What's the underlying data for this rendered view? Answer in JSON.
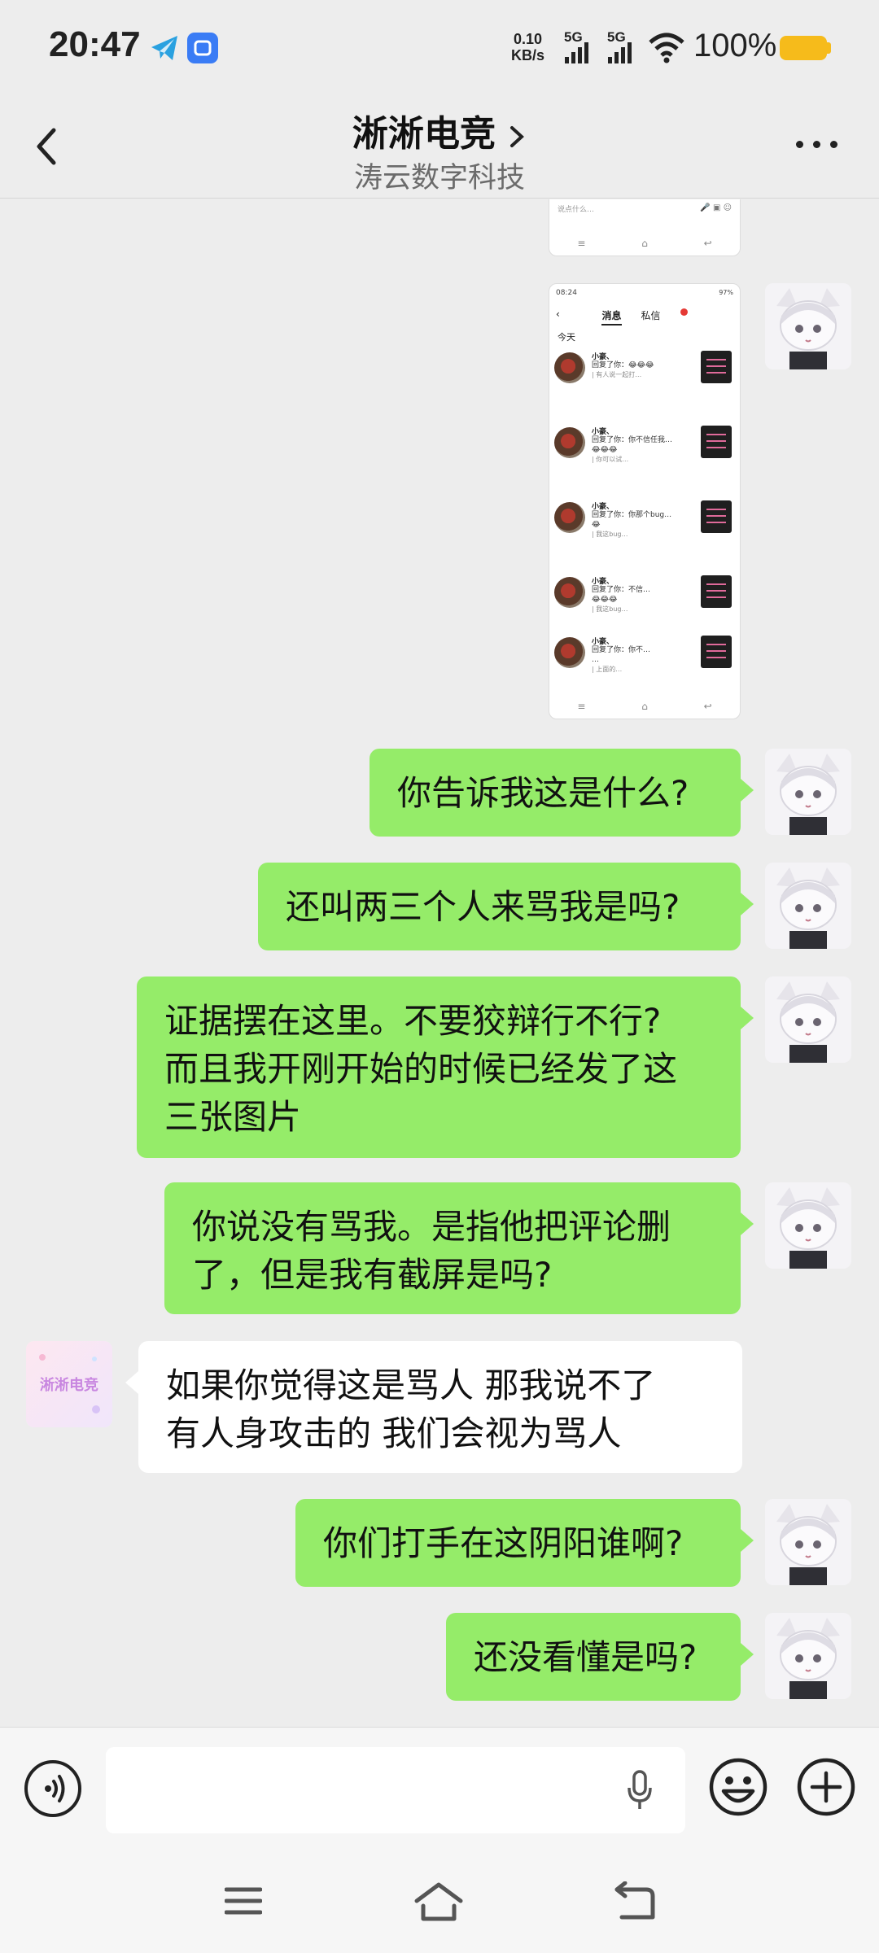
{
  "status_bar": {
    "time": "20:47",
    "net_speed_value": "0.10",
    "net_speed_unit": "KB/s",
    "net1": "5G",
    "net2": "5G",
    "battery": "100%",
    "battery_color": "#f6bb1b",
    "app_icons": [
      "telegram-icon",
      "blue-app-icon"
    ]
  },
  "header": {
    "title": "淅淅电竞",
    "subtitle": "涛云数字科技"
  },
  "thumbnail_top": {
    "input_placeholder": "说点什么…"
  },
  "screenshot": {
    "status_time": "08:24",
    "status_right": "97%",
    "tab_messages": "消息",
    "tab_notifications": "私信",
    "section": "今天",
    "items": [
      {
        "name": "小豪、",
        "text": "回复了你：😂😂😂",
        "quote": "| 有人说一起打…"
      },
      {
        "name": "小豪、",
        "text": "回复了你：你不信任我…\n😂😂😂",
        "quote": "| 你可以试…"
      },
      {
        "name": "小豪、",
        "text": "回复了你：你那个bug…\n😂",
        "quote": "| 我这bug…"
      },
      {
        "name": "小豪、",
        "text": "回复了你：不信…\n😂😂😂",
        "quote": "| 我这bug…"
      },
      {
        "name": "小豪、",
        "text": "回复了你：你不…\n…",
        "quote": "| 上面的…"
      }
    ]
  },
  "messages": [
    {
      "from": "me",
      "text": "你告诉我这是什么?"
    },
    {
      "from": "me",
      "text": "还叫两三个人来骂我是吗?"
    },
    {
      "from": "me",
      "text": "证据摆在这里。不要狡辩行不行?\n而且我开刚开始的时候已经发了这\n三张图片"
    },
    {
      "from": "me",
      "text": "你说没有骂我。是指他把评论删\n了，但是我有截屏是吗?"
    },
    {
      "from": "other",
      "text": "如果你觉得这是骂人 那我说不了\n有人身攻击的 我们会视为骂人",
      "avatar_text": "淅淅电竞"
    },
    {
      "from": "me",
      "text": "你们打手在这阴阳谁啊?"
    },
    {
      "from": "me",
      "text": "还没看懂是吗?"
    }
  ],
  "colors": {
    "my_bubble": "#95ec69",
    "other_bubble": "#ffffff",
    "background": "#ededed"
  }
}
